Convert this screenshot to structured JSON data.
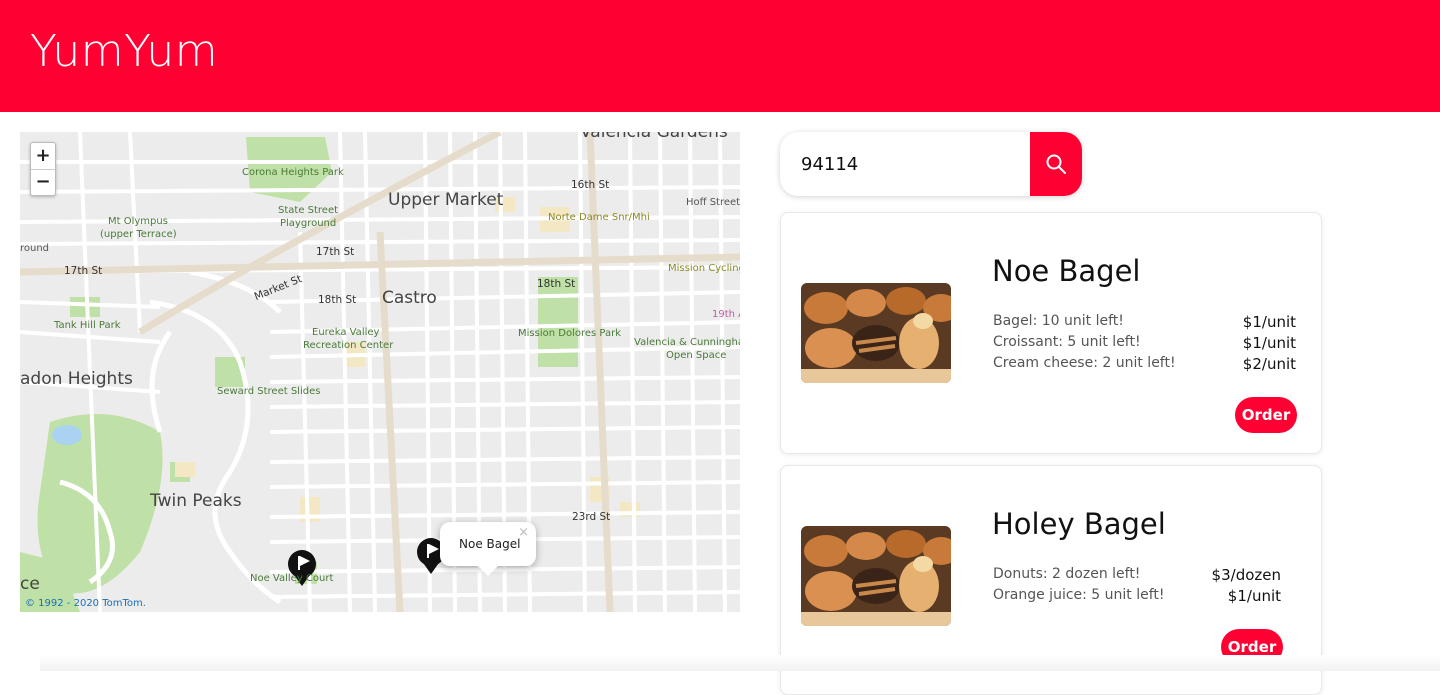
{
  "header": {
    "brand": "YumYum"
  },
  "map": {
    "zoom_in": "+",
    "zoom_out": "−",
    "attribution": "© 1992 - 2020 TomTom.",
    "popup": {
      "text": "Noe Bagel",
      "close": "×"
    },
    "labels": {
      "valencia_gardens": "Valencia Gardens",
      "corona_heights": "Corona Heights Park",
      "upper_market": "Upper Market",
      "sixteenth": "16th St",
      "hoff": "Hoff Street",
      "state_street": "State Street",
      "playground": "Playground",
      "norte_dame": "Norte Dame Snr/Mhi",
      "mt_olympus": "Mt Olympus",
      "upper_terrace": "(upper Terrace)",
      "round": "round",
      "seventeenth_a": "17th St",
      "seventeenth_b": "17th St",
      "mission_cycling": "Mission Cycling",
      "market_st": "Market St",
      "eighteenth_a": "18th St",
      "castro": "Castro",
      "eighteenth_b": "18th St",
      "nineteenth": "19th A",
      "tank_hill": "Tank Hill Park",
      "eureka_valley": "Eureka Valley",
      "rec_center": "Recreation Center",
      "mission_dolores": "Mission Dolores Park",
      "valencia_cunningham": "Valencia & Cunningha",
      "open_space": "Open Space",
      "adon_heights": "adon Heights",
      "seward": "Seward Street Slides",
      "twin_peaks": "Twin Peaks",
      "twentythird": "23rd St",
      "noe_valley": "Noe Valley Court",
      "ce": "ce"
    }
  },
  "search": {
    "value": "94114",
    "icon": "search-icon"
  },
  "stores": [
    {
      "name": "Noe Bagel",
      "items": [
        {
          "label": "Bagel: 10 unit left!",
          "price": "$1/unit"
        },
        {
          "label": "Croissant: 5 unit left!",
          "price": "$1/unit"
        },
        {
          "label": "Cream cheese: 2 unit left!",
          "price": "$2/unit"
        }
      ],
      "order_label": "Order"
    },
    {
      "name": "Holey Bagel",
      "items": [
        {
          "label": "Donuts: 2 dozen left!",
          "price": "$3/dozen"
        },
        {
          "label": "Orange juice: 5 unit left!",
          "price": "$1/unit"
        }
      ],
      "order_label": "Order"
    }
  ],
  "colors": {
    "brand": "#ff0033",
    "park": "#bfe0a6",
    "road": "#ffffff",
    "major_road": "#e6dccb"
  }
}
